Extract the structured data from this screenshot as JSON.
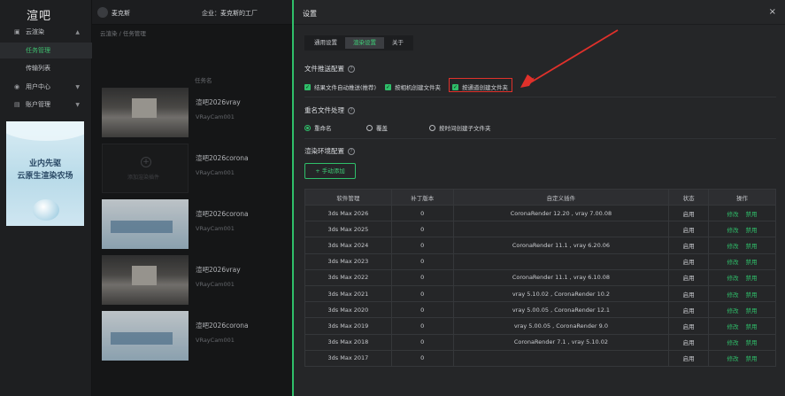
{
  "app": {
    "logo": "渲吧"
  },
  "sidebar": {
    "items": [
      {
        "label": "云渲染",
        "icon": "image-icon"
      },
      {
        "label": "任务管理"
      },
      {
        "label": "传输列表"
      },
      {
        "label": "用户中心",
        "icon": "user-icon"
      },
      {
        "label": "账户管理",
        "icon": "wallet-icon"
      }
    ],
    "promo": {
      "line1": "业内先驱",
      "line2": "云原生渲染农场"
    }
  },
  "header": {
    "user": "麦克斯",
    "company": "企业：麦克斯的工厂"
  },
  "breadcrumb": "云渲染 / 任务管理",
  "task_list": {
    "column_header": "任务名",
    "empty_thumb_text": "添加渲染插件",
    "rows": [
      {
        "name": "渲吧2026vray",
        "camera": "VRayCam001",
        "thumb": "room"
      },
      {
        "name": "渲吧2026corona",
        "camera": "VRayCam001",
        "thumb": "empty"
      },
      {
        "name": "渲吧2026corona",
        "camera": "VRayCam001",
        "thumb": "blue"
      },
      {
        "name": "渲吧2026vray",
        "camera": "VRayCam001",
        "thumb": "room"
      },
      {
        "name": "渲吧2026corona",
        "camera": "VRayCam001",
        "thumb": "blue"
      }
    ]
  },
  "settings": {
    "title": "设置",
    "close": "×",
    "tabs": [
      "通用设置",
      "渲染设置",
      "关于"
    ],
    "active_tab": 1,
    "output_section": {
      "title": "文件推送配置",
      "options": [
        "结果文件自动推送(推荐)",
        "按相机创建文件夹",
        "按通道创建文件夹"
      ]
    },
    "rename_section": {
      "title": "重名文件处理",
      "options": [
        "重命名",
        "覆盖",
        "按时间创建子文件夹"
      ],
      "selected": 0
    },
    "env_section": {
      "title": "渲染环境配置",
      "add_button": "+ 手动添加",
      "headers": [
        "软件管理",
        "补丁版本",
        "自定义插件",
        "状态",
        "操作"
      ],
      "rows": [
        {
          "software": "3ds Max 2026",
          "patch": "0",
          "plugins": "CoronaRender 12.20 , vray 7.00.08",
          "status": "启用",
          "edit": "修改",
          "disable": "禁用"
        },
        {
          "software": "3ds Max 2025",
          "patch": "0",
          "plugins": "",
          "status": "启用",
          "edit": "修改",
          "disable": "禁用"
        },
        {
          "software": "3ds Max 2024",
          "patch": "0",
          "plugins": "CoronaRender 11.1 , vray 6.20.06",
          "status": "启用",
          "edit": "修改",
          "disable": "禁用"
        },
        {
          "software": "3ds Max 2023",
          "patch": "0",
          "plugins": "",
          "status": "启用",
          "edit": "修改",
          "disable": "禁用"
        },
        {
          "software": "3ds Max 2022",
          "patch": "0",
          "plugins": "CoronaRender 11.1 , vray 6.10.08",
          "status": "启用",
          "edit": "修改",
          "disable": "禁用"
        },
        {
          "software": "3ds Max 2021",
          "patch": "0",
          "plugins": "vray 5.10.02 , CoronaRender 10.2",
          "status": "启用",
          "edit": "修改",
          "disable": "禁用"
        },
        {
          "software": "3ds Max 2020",
          "patch": "0",
          "plugins": "vray 5.00.05 , CoronaRender 12.1",
          "status": "启用",
          "edit": "修改",
          "disable": "禁用"
        },
        {
          "software": "3ds Max 2019",
          "patch": "0",
          "plugins": "vray 5.00.05 , CoronaRender 9.0",
          "status": "启用",
          "edit": "修改",
          "disable": "禁用"
        },
        {
          "software": "3ds Max 2018",
          "patch": "0",
          "plugins": "CoronaRender 7.1 , vray 5.10.02",
          "status": "启用",
          "edit": "修改",
          "disable": "禁用"
        },
        {
          "software": "3ds Max 2017",
          "patch": "0",
          "plugins": "",
          "status": "启用",
          "edit": "修改",
          "disable": "禁用"
        }
      ]
    }
  },
  "colors": {
    "accent": "#2fbf6a",
    "annotation": "#e0312b",
    "panel_bg": "#252628"
  }
}
